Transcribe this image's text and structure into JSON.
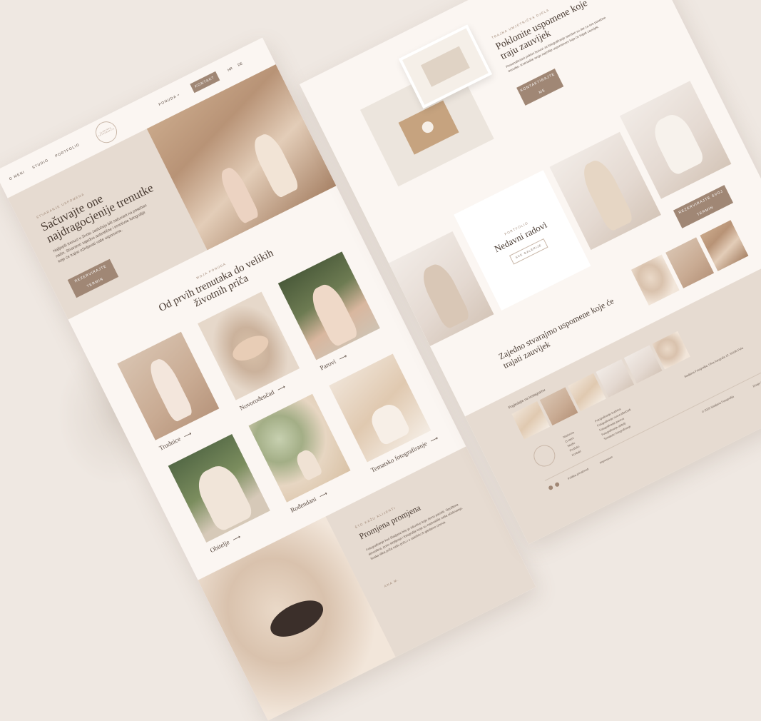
{
  "left_page": {
    "nav": {
      "items": [
        "O MENI",
        "STUDIO",
        "PORTFOLIO"
      ],
      "logo_text": "SLADJANA FOTOGRAFIJA",
      "ponuda": "PONUDA",
      "contact_button": "KONTAKT",
      "languages": [
        "HR",
        "DE"
      ]
    },
    "hero": {
      "eyebrow": "STVARANJE USPOMENA",
      "title": "Sačuvajte one najdragocjenije trenutke",
      "text": "Najljepši trenuci u životu zaslužuju biti sačuvani na poseban način. Stvaramo zajedno autentične i emotivne fotografije koje će trajno oživljavati vaše uspomene.",
      "button": "REZERVIRAJTE TERMIN"
    },
    "offer": {
      "eyebrow": "MOJA PONUDA",
      "title": "Od prvih trenutaka do velikih životnih priča",
      "items": [
        {
          "label": "Trudnice",
          "arrow": "⟶"
        },
        {
          "label": "Novorođenčad",
          "arrow": "⟶"
        },
        {
          "label": "Parovi",
          "arrow": "⟶"
        },
        {
          "label": "Obitelje",
          "arrow": "⟶"
        },
        {
          "label": "Rođendani",
          "arrow": "⟶"
        },
        {
          "label": "Tematsko fotografiranje",
          "arrow": "⟶"
        }
      ]
    },
    "testimonial": {
      "eyebrow": "ŠTO KAŽU KLIJENTI",
      "title": "Promjena promjena",
      "text": "Fotografiranje kod Sladjane bilo je iskustvo koje ćemo pamtiti. Opuštena atmosfera, puno strpljenja i fotografije koje su nadmašile naša očekivanja. Svaka slika priča našu priču i s radošću ih gledamo iznova.",
      "author": "ANA M."
    }
  },
  "right_page": {
    "gift": {
      "eyebrow": "TRAJNA UMJETNIČKA DJELA",
      "title": "Poklonite uspomene koje traju zauvijek",
      "text": "Personalizirani poklon bonovi za fotografiranje savršen su dar za sve posebne trenutke. Iznenadite svoje najmilije uspomenom koja će trajati zauvijek.",
      "button": "KONTAKTIRAJTE ME"
    },
    "portfolio": {
      "eyebrow": "PORTFOLIO",
      "title": "Nedavni radovi",
      "button": "SVE GALERIJE",
      "reserve_button": "REZERVIRAJTE SVOJ TERMIN"
    },
    "closing": {
      "title": "Zajedno stvarajmo uspomene koje će trajati zauvijek"
    },
    "footer": {
      "instagram_label": "Pogledajte na Instagramu",
      "nav_links": [
        "Naslovna",
        "O meni",
        "Studio",
        "Portfolio",
        "Kontakt"
      ],
      "offer_links": [
        "Fotografiranje trudnica",
        "Fotografiranje novorođenčadi",
        "Fotografiranje parova",
        "Fotografiranje obitelji",
        "Tematsko fotografiranje"
      ],
      "address": "Sladjana Fotografija, Ulica fotografa 12, 52100 Pula",
      "legal_links": [
        "Politika privatnosti",
        "Impressum"
      ],
      "copyright": "© 2025 Sladjana Fotografija",
      "credit": "Dizajn i razvoj: Studio Web"
    }
  }
}
